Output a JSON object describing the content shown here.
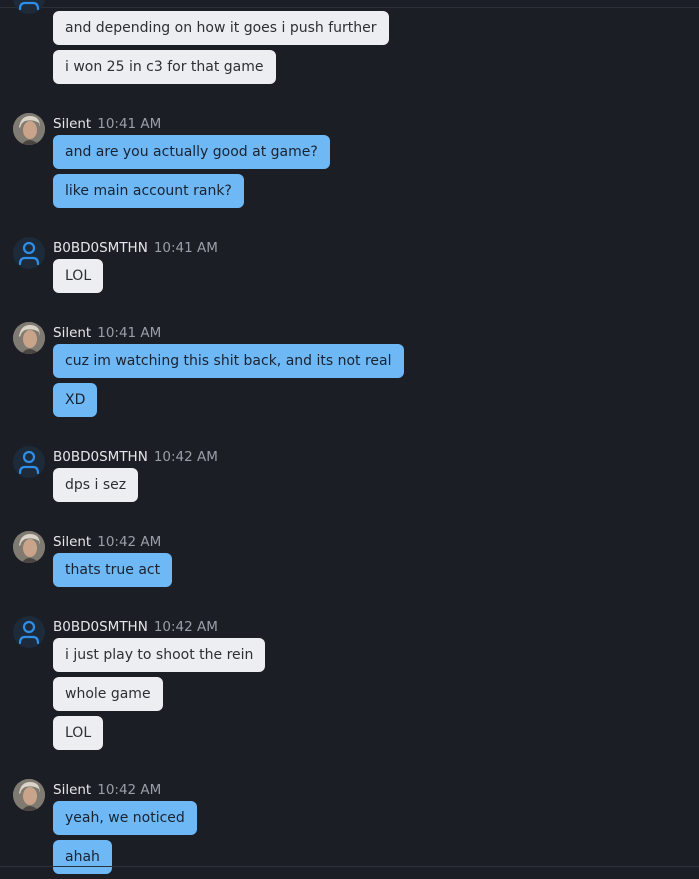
{
  "colors": {
    "background": "#1b1e24",
    "self_bubble": "#6eb8f5",
    "peer_bubble": "#eceef1",
    "user_icon": "#2f8fe6"
  },
  "top_group": {
    "messages": [
      "and depending on how it goes i push further",
      "i won 25 in c3 for that game"
    ]
  },
  "groups": [
    {
      "sender": "Silent",
      "time": "10:41 AM",
      "avatar": "silent-avatar",
      "side": "self",
      "messages": [
        "and are you actually good at game?",
        "like main account rank?"
      ]
    },
    {
      "sender": "B0BD0SMTHN",
      "time": "10:41 AM",
      "avatar": "default-user-icon",
      "side": "peer",
      "messages": [
        "LOL"
      ]
    },
    {
      "sender": "Silent",
      "time": "10:41 AM",
      "avatar": "silent-avatar",
      "side": "self",
      "messages": [
        "cuz im watching this shit back, and its not real",
        "XD"
      ]
    },
    {
      "sender": "B0BD0SMTHN",
      "time": "10:42 AM",
      "avatar": "default-user-icon",
      "side": "peer",
      "messages": [
        "dps i sez"
      ]
    },
    {
      "sender": "Silent",
      "time": "10:42 AM",
      "avatar": "silent-avatar",
      "side": "self",
      "messages": [
        "thats true act"
      ]
    },
    {
      "sender": "B0BD0SMTHN",
      "time": "10:42 AM",
      "avatar": "default-user-icon",
      "side": "peer",
      "messages": [
        "i just play to shoot the rein",
        "whole game",
        "LOL"
      ]
    },
    {
      "sender": "Silent",
      "time": "10:42 AM",
      "avatar": "silent-avatar",
      "side": "self",
      "messages": [
        "yeah, we noticed",
        "ahah"
      ]
    }
  ]
}
